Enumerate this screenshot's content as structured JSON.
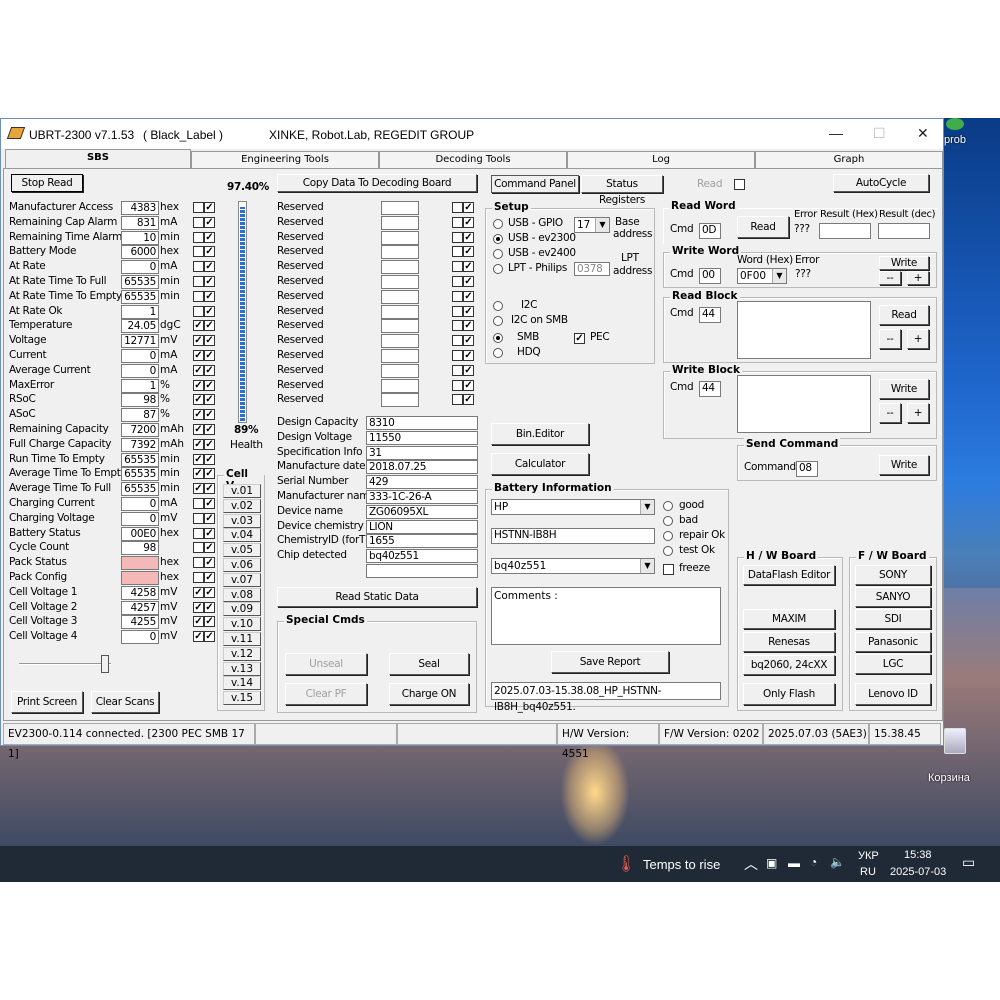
{
  "window": {
    "title": "UBRT-2300 v7.1.53",
    "label": "( Black_Label )",
    "company": "XINKE,  Robot.Lab,  REGEDIT GROUP"
  },
  "tabs": [
    "SBS",
    "Engineering Tools",
    "Decoding Tools",
    "Log",
    "Graph"
  ],
  "sbs": {
    "stop_read": "Stop Read",
    "percent": "97.40%",
    "health_value": "89%",
    "health_label": "Health",
    "copy_button": "Copy Data To Decoding Board",
    "rows": [
      {
        "label": "Manufacturer Access",
        "value": "4383",
        "unit": "hex",
        "c1": "",
        "c2": "✓"
      },
      {
        "label": "Remaining Cap Alarm",
        "value": "831",
        "unit": "mA",
        "c1": "",
        "c2": "✓"
      },
      {
        "label": "Remaining Time Alarm",
        "value": "10",
        "unit": "min",
        "c1": "",
        "c2": "✓"
      },
      {
        "label": "Battery Mode",
        "value": "6000",
        "unit": "hex",
        "c1": "",
        "c2": "✓"
      },
      {
        "label": "At Rate",
        "value": "0",
        "unit": "mA",
        "c1": "",
        "c2": "✓"
      },
      {
        "label": "At Rate Time To Full",
        "value": "65535",
        "unit": "min",
        "c1": "",
        "c2": "✓"
      },
      {
        "label": "At Rate Time To Empty",
        "value": "65535",
        "unit": "min",
        "c1": "",
        "c2": "✓"
      },
      {
        "label": "At Rate Ok",
        "value": "1",
        "unit": "",
        "c1": "",
        "c2": "✓"
      },
      {
        "label": "Temperature",
        "value": "24.05",
        "unit": "dgC",
        "c1": "✓",
        "c2": "✓"
      },
      {
        "label": "Voltage",
        "value": "12771",
        "unit": "mV",
        "c1": "✓",
        "c2": "✓"
      },
      {
        "label": "Current",
        "value": "0",
        "unit": "mA",
        "c1": "✓",
        "c2": "✓"
      },
      {
        "label": "Average Current",
        "value": "0",
        "unit": "mA",
        "c1": "✓",
        "c2": "✓"
      },
      {
        "label": "MaxError",
        "value": "1",
        "unit": "%",
        "c1": "✓",
        "c2": "✓"
      },
      {
        "label": "RSoC",
        "value": "98",
        "unit": "%",
        "c1": "✓",
        "c2": "✓"
      },
      {
        "label": "ASoC",
        "value": "87",
        "unit": "%",
        "c1": "✓",
        "c2": "✓"
      },
      {
        "label": "Remaining Capacity",
        "value": "7200",
        "unit": "mAh",
        "c1": "✓",
        "c2": "✓"
      },
      {
        "label": "Full Charge Capacity",
        "value": "7392",
        "unit": "mAh",
        "c1": "✓",
        "c2": "✓"
      },
      {
        "label": "Run Time To Empty",
        "value": "65535",
        "unit": "min",
        "c1": "✓",
        "c2": "✓"
      },
      {
        "label": "Average Time To Empty",
        "value": "65535",
        "unit": "min",
        "c1": "✓",
        "c2": "✓"
      },
      {
        "label": "Average Time To Full",
        "value": "65535",
        "unit": "min",
        "c1": "✓",
        "c2": "✓"
      },
      {
        "label": "Charging Current",
        "value": "0",
        "unit": "mA",
        "c1": "",
        "c2": "✓"
      },
      {
        "label": "Charging Voltage",
        "value": "0",
        "unit": "mV",
        "c1": "",
        "c2": "✓"
      },
      {
        "label": "Battery Status",
        "value": "00E0",
        "unit": "hex",
        "c1": "",
        "c2": "✓"
      },
      {
        "label": "Cycle Count",
        "value": "98",
        "unit": "",
        "c1": "",
        "c2": "✓"
      },
      {
        "label": "Pack Status",
        "value": "",
        "unit": "hex",
        "c1": "",
        "c2": "✓",
        "pink": true
      },
      {
        "label": "Pack Config",
        "value": "",
        "unit": "hex",
        "c1": "",
        "c2": "✓",
        "pink": true
      },
      {
        "label": "Cell Voltage 1",
        "value": "4258",
        "unit": "mV",
        "c1": "✓",
        "c2": "✓"
      },
      {
        "label": "Cell Voltage 2",
        "value": "4257",
        "unit": "mV",
        "c1": "✓",
        "c2": "✓"
      },
      {
        "label": "Cell Voltage 3",
        "value": "4255",
        "unit": "mV",
        "c1": "✓",
        "c2": "✓"
      },
      {
        "label": "Cell Voltage 4",
        "value": "0",
        "unit": "mV",
        "c1": "✓",
        "c2": "✓"
      }
    ],
    "reserved": [
      "Reserved",
      "Reserved",
      "Reserved",
      "Reserved",
      "Reserved",
      "Reserved",
      "Reserved",
      "Reserved",
      "Reserved",
      "Reserved",
      "Reserved",
      "Reserved",
      "Reserved",
      "Reserved"
    ],
    "cellv_title": "Cell V.",
    "cellv": [
      "v.01",
      "v.02",
      "v.03",
      "v.04",
      "v.05",
      "v.06",
      "v.07",
      "v.08",
      "v.09",
      "v.10",
      "v.11",
      "v.12",
      "v.13",
      "v.14",
      "v.15"
    ],
    "info": [
      {
        "label": "Design Capacity",
        "value": "8310"
      },
      {
        "label": "Design Voltage",
        "value": "11550"
      },
      {
        "label": "Specification Info",
        "value": "31"
      },
      {
        "label": "Manufacture date",
        "value": "2018.07.25"
      },
      {
        "label": "Serial Number",
        "value": "429"
      },
      {
        "label": "Manufacturer name",
        "value": "333-1C-26-A"
      },
      {
        "label": "Device name",
        "value": "ZG06095XL"
      },
      {
        "label": "Device chemistry",
        "value": "LION"
      },
      {
        "label": "ChemistryID (forTI)",
        "value": "1655"
      },
      {
        "label": "Chip detected",
        "value": "bq40z551"
      },
      {
        "label": "",
        "value": ""
      }
    ],
    "read_static": "Read Static Data",
    "special_title": "Special Cmds",
    "unseal": "Unseal",
    "seal": "Seal",
    "clear_pf": "Clear PF",
    "charge_on": "Charge ON",
    "print_screen": "Print Screen",
    "clear_scans": "Clear Scans"
  },
  "panel": {
    "command_panel": "Command Panel",
    "status_registers": "Status Registers",
    "read": "Read",
    "autocycle": "AutoCycle",
    "setup_title": "Setup",
    "usb_gpio": "USB - GPIO",
    "usb_ev2300": "USB - ev2300",
    "usb_ev2400": "USB - ev2400",
    "lpt": "LPT - Philips",
    "base_addr_value": "17",
    "base_addr_label1": "Base",
    "base_addr_label2": "address",
    "lpt_addr_value": "0378",
    "lpt_addr_label1": "LPT",
    "lpt_addr_label2": "address",
    "i2c": "I2C",
    "i2c_smb": "I2C on SMB",
    "smb": "SMB",
    "hdq": "HDQ",
    "pec": "PEC",
    "bin_editor": "Bin.Editor",
    "calculator": "Calculator",
    "battinfo_title": "Battery Information",
    "brand": "HP",
    "model": "HSTNN-IB8H",
    "chip": "bq40z551",
    "good": "good",
    "bad": "bad",
    "repair_ok": "repair Ok",
    "test_ok": "test  Ok",
    "freeze": "freeze",
    "comments": "Comments :",
    "save_report": "Save Report",
    "report_file": "2025.07.03-15.38.08_HP_HSTNN-IB8H_bq40z551."
  },
  "rw": {
    "read_word_title": "Read Word",
    "cmd": "Cmd",
    "rw_cmd": "0D",
    "read": "Read",
    "error": "Error",
    "result_hex": "Result (Hex)",
    "result_dec": "Result (dec)",
    "qqq": "???",
    "write_word_title": "Write Word",
    "ww_cmd": "00",
    "word_hex": "Word (Hex)",
    "word_val": "0F00",
    "write": "Write",
    "minus": "--",
    "plus": "+",
    "read_block_title": "Read Block",
    "rb_cmd": "44",
    "write_block_title": "Write Block",
    "wb_cmd": "44",
    "send_cmd_title": "Send Command",
    "command": "Command",
    "sc_val": "08"
  },
  "hw": {
    "title": "H / W   Board",
    "dataflash": "DataFlash Editor",
    "maxim": "MAXIM",
    "renesas": "Renesas",
    "bq2060": "bq2060, 24cXX",
    "only_flash": "Only Flash"
  },
  "fw": {
    "title": "F / W   Board",
    "sony": "SONY",
    "sanyo": "SANYO",
    "sdi": "SDI",
    "panasonic": "Panasonic",
    "lgc": "LGC",
    "lenovo": "Lenovo ID"
  },
  "statusbar": {
    "conn": "EV2300-0.114 connected. [2300  PEC  SMB  17 1]",
    "hw": "H/W Version:  4551",
    "fw": "F/W Version:  0202",
    "date": "2025.07.03  (5AE3)",
    "time": "15.38.45"
  },
  "desktop": {
    "prob": "prob",
    "trash": "Корзина"
  },
  "taskbar": {
    "weather": "Temps to rise",
    "lang1": "УКР",
    "lang2": "RU",
    "time": "15:38",
    "date": "2025-07-03"
  },
  "colors": {
    "pink": "#f4b8b8",
    "progress": "#2d6fd0"
  }
}
